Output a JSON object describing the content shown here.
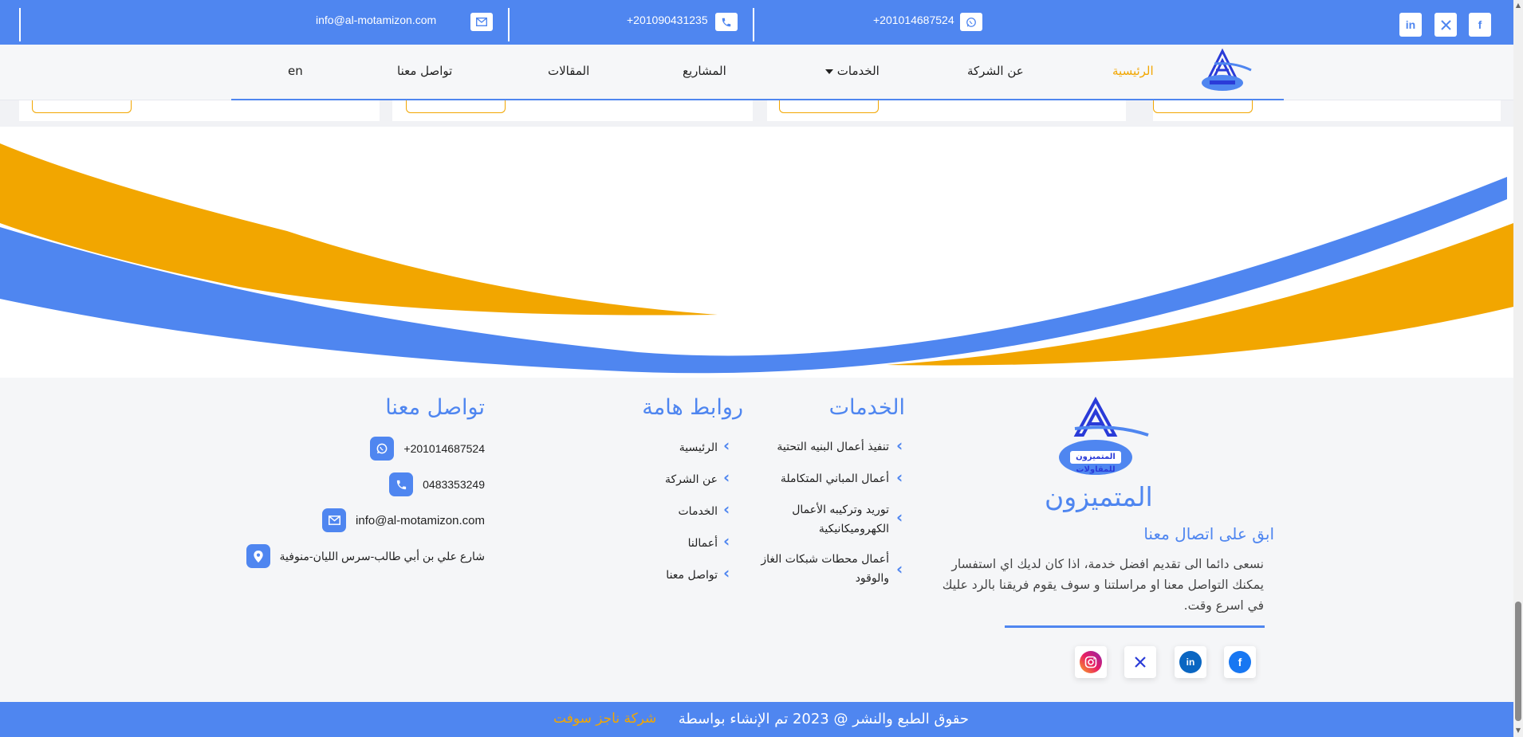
{
  "topbar": {
    "email": "info@al-motamizon.com",
    "phone": "+201090431235",
    "whatsapp": "+201014687524",
    "social": [
      "linkedin-icon",
      "x-icon",
      "facebook-icon"
    ]
  },
  "nav": {
    "items": [
      "الرئيسية",
      "عن الشركة",
      "الخدمات",
      "المشاريع",
      "المقالات",
      "تواصل معنا"
    ],
    "lang": "en",
    "active_color": "#f2a600"
  },
  "footer": {
    "brand": {
      "logo_text": "المتميزون للمقاولات",
      "name": "المتميزون",
      "subheading": "ابق على اتصال معنا",
      "description": "نسعى دائما الى تقديم افضل خدمة، اذا كان لديك اي استفسار يمكنك التواصل معنا او مراسلتنا و سوف يقوم فريقنا بالرد عليك في اسرع وقت."
    },
    "services": {
      "heading": "الخدمات",
      "items": [
        "تنفيذ أعمال البنيه التحتية",
        "أعمال المباني المتكاملة",
        "توريد وتركيبه الأعمال الكهروميكانيكية",
        "أعمال محطات شبكات الغاز والوقود"
      ]
    },
    "links": {
      "heading": "روابط هامة",
      "items": [
        "الرئيسية",
        "عن الشركة",
        "الخدمات",
        "أعمالنا",
        "تواصل معنا"
      ]
    },
    "contact": {
      "heading": "تواصل معنا",
      "whatsapp": "+201014687524",
      "phone": "0483353249",
      "email": "info@al-motamizon.com",
      "address": "شارع علي بن أبي طالب-سرس الليان-منوفية"
    },
    "social": [
      "facebook-icon",
      "linkedin-icon",
      "x-icon",
      "instagram-icon"
    ]
  },
  "copyright": {
    "text": "حقوق الطبع والنشر @ 2023 تم الإنشاء بواسطة",
    "company": "شركة ناجز سوفت"
  },
  "colors": {
    "primary": "#4f86f0",
    "accent": "#f2a600"
  }
}
